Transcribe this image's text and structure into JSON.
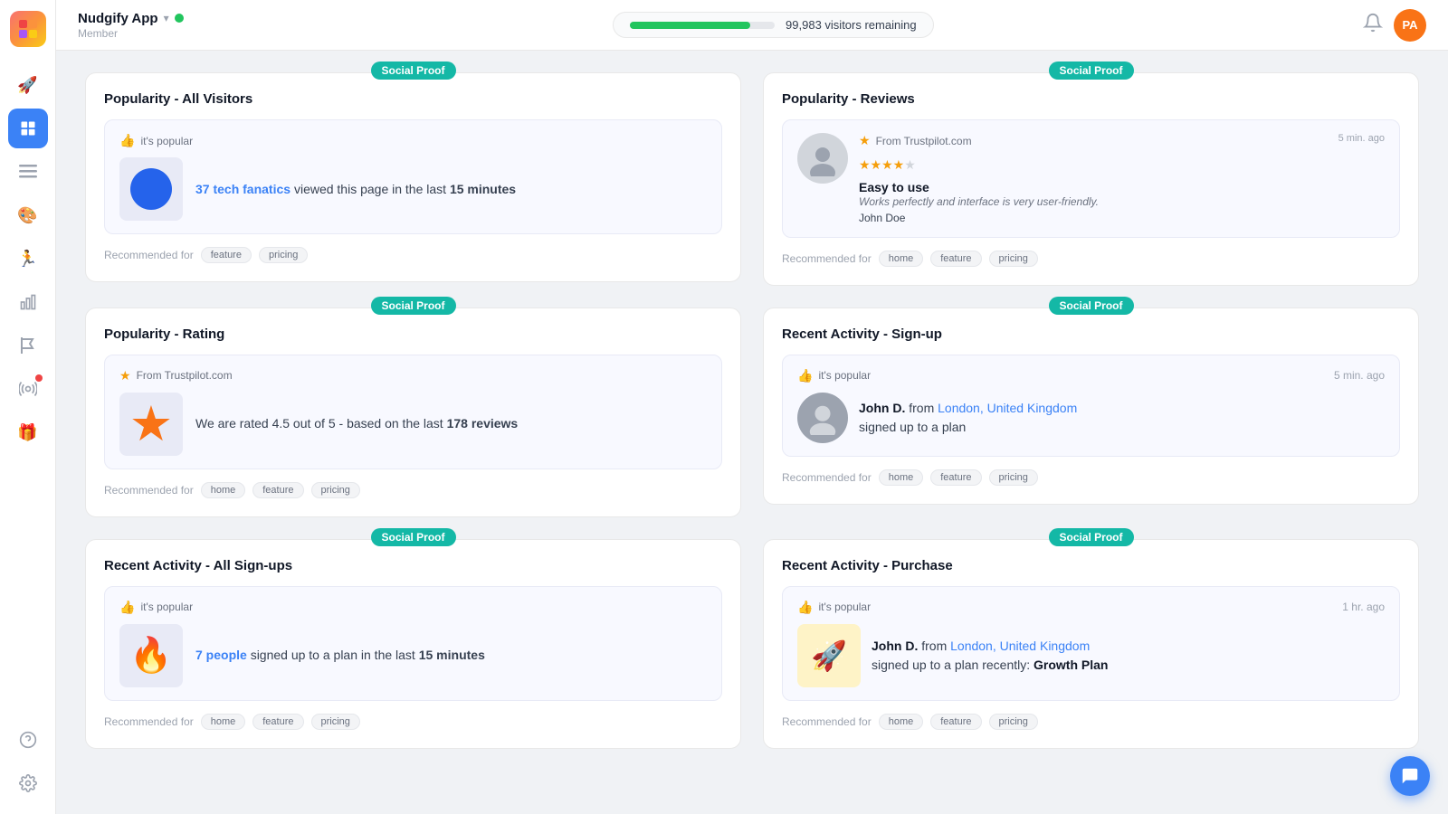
{
  "app": {
    "name": "Nudgify App",
    "member_label": "Member",
    "status": "online"
  },
  "header": {
    "visitors_remaining": "99,983 visitors remaining",
    "progress_percent": 83,
    "avatar_initials": "PA"
  },
  "sidebar": {
    "items": [
      {
        "id": "rocket",
        "icon": "🚀",
        "active": false
      },
      {
        "id": "dashboard",
        "icon": "▦",
        "active": true
      },
      {
        "id": "list",
        "icon": "≡",
        "active": false
      },
      {
        "id": "palette",
        "icon": "🎨",
        "active": false
      },
      {
        "id": "activity",
        "icon": "🏃",
        "active": false
      },
      {
        "id": "chart",
        "icon": "📊",
        "active": false
      },
      {
        "id": "flag",
        "icon": "⚑",
        "active": false
      },
      {
        "id": "broadcast",
        "icon": "📡",
        "active": false,
        "badge": true
      },
      {
        "id": "gift",
        "icon": "🎁",
        "active": false
      }
    ],
    "bottom": [
      {
        "id": "help",
        "icon": "?"
      },
      {
        "id": "settings",
        "icon": "⚙"
      }
    ]
  },
  "cards": [
    {
      "id": "popularity-all-visitors",
      "badge": "Social Proof",
      "title": "Popularity - All Visitors",
      "preview_top_icon": "thumb_up",
      "preview_top_text": "it's popular",
      "preview_type": "popularity",
      "highlight_text": "37 tech fanatics",
      "body_text": " viewed this page in the last ",
      "body_bold": "15 minutes",
      "recommended_label": "Recommended for",
      "tags": [
        "feature",
        "pricing"
      ]
    },
    {
      "id": "popularity-reviews",
      "badge": "Social Proof",
      "title": "Popularity - Reviews",
      "preview_type": "review",
      "trustpilot": "From Trustpilot.com",
      "time": "5 min. ago",
      "stars": 4,
      "max_stars": 5,
      "review_title": "Easy to use",
      "review_body": "Works perfectly and interface is very user-friendly.",
      "review_author": "John Doe",
      "recommended_label": "Recommended for",
      "tags": [
        "home",
        "feature",
        "pricing"
      ]
    },
    {
      "id": "popularity-rating",
      "badge": "Social Proof",
      "title": "Popularity - Rating",
      "preview_type": "rating",
      "trustpilot": "From Trustpilot.com",
      "rating_highlight": "4.5",
      "rating_text": "We are rated ",
      "rating_after": " out of 5 - based on the last ",
      "rating_reviews": "178 reviews",
      "recommended_label": "Recommended for",
      "tags": [
        "home",
        "feature",
        "pricing"
      ]
    },
    {
      "id": "recent-activity-signup",
      "badge": "Social Proof",
      "title": "Recent Activity - Sign-up",
      "preview_type": "activity",
      "preview_top_icon": "thumb_up",
      "preview_top_text": "it's popular",
      "time": "5 min. ago",
      "person_name": "John D.",
      "person_from": " from ",
      "person_location": "London, United Kingdom",
      "activity_action": "signed up to a plan",
      "recommended_label": "Recommended for",
      "tags": [
        "home",
        "feature",
        "pricing"
      ]
    },
    {
      "id": "recent-activity-all-signups",
      "badge": "Social Proof",
      "title": "Recent Activity - All Sign-ups",
      "preview_top_icon": "thumb_up",
      "preview_top_text": "it's popular",
      "preview_type": "fire",
      "highlight_text": "7 people",
      "body_text": " signed up to a plan in the last ",
      "body_bold": "15 minutes",
      "recommended_label": "Recommended for",
      "tags": [
        "home",
        "feature",
        "pricing"
      ]
    },
    {
      "id": "recent-activity-purchase",
      "badge": "Social Proof",
      "title": "Recent Activity - Purchase",
      "preview_type": "purchase",
      "preview_top_icon": "thumb_up",
      "preview_top_text": "it's popular",
      "time": "1 hr. ago",
      "person_name": "John D.",
      "person_from": " from ",
      "person_location": "London, United Kingdom",
      "activity_action": "signed up to a plan recently: ",
      "activity_link": "Growth Plan",
      "recommended_label": "Recommended for",
      "tags": [
        "home",
        "feature",
        "pricing"
      ]
    }
  ]
}
